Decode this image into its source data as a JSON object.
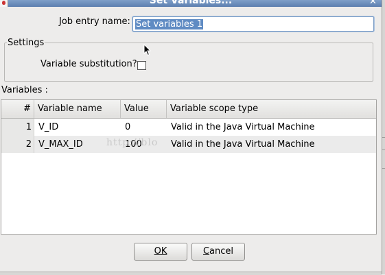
{
  "window": {
    "title": "Set Variables...",
    "close_symbol": "✕"
  },
  "form": {
    "job_entry_label": "Job entry name:",
    "job_entry_value": "Set variables 1",
    "settings_legend": "Settings",
    "variable_substitution_label": "Variable substitution?",
    "variable_substitution_checked": false,
    "variables_label": "Variables :"
  },
  "table": {
    "headers": [
      "#",
      "Variable name",
      "Value",
      "Variable scope type"
    ],
    "rows": [
      {
        "num": "1",
        "name": "V_ID",
        "value": "0",
        "scope": "Valid in the Java Virtual Machine"
      },
      {
        "num": "2",
        "name": "V_MAX_ID",
        "value": "100",
        "scope": "Valid in the Java Virtual Machine"
      }
    ]
  },
  "watermark": "http://blo",
  "buttons": {
    "ok_label": "OK",
    "cancel_label": "Cancel"
  },
  "colors": {
    "title_bar": "#6a8cbc",
    "selection": "#5f8bc3",
    "background": "#edeceb"
  },
  "icons": {
    "app": "app-icon",
    "close": "close-icon",
    "pointer": "mouse-pointer-icon"
  }
}
